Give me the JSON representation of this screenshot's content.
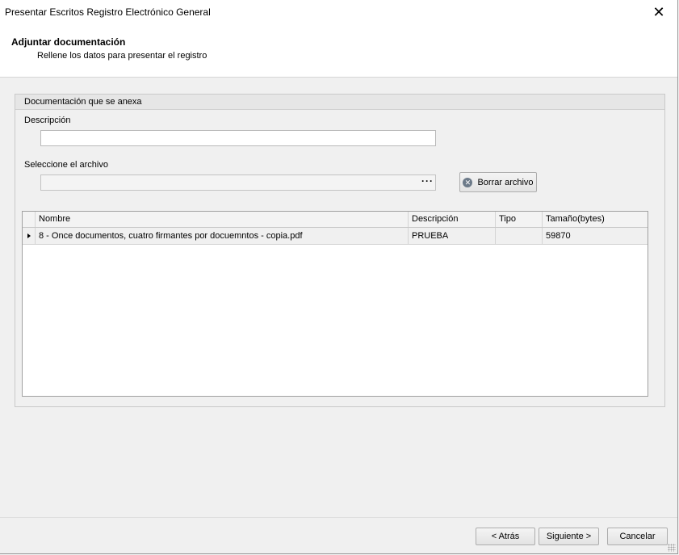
{
  "window": {
    "title": "Presentar Escritos Registro Electrónico General",
    "close_glyph": "✕"
  },
  "header": {
    "title": "Adjuntar documentación",
    "subtitle": "Rellene los datos para presentar el registro"
  },
  "group": {
    "title": "Documentación que se anexa",
    "description_label": "Descripción",
    "description_value": "",
    "file_label": "Seleccione el archivo",
    "file_value": "",
    "browse_glyph": "···",
    "clear_button_label": "Borrar archivo",
    "clear_icon": "delete-circle-icon"
  },
  "grid": {
    "columns": [
      "Nombre",
      "Descripción",
      "Tipo",
      "Tamaño(bytes)"
    ],
    "rows": [
      {
        "nombre": "8 - Once documentos, cuatro firmantes por docuemntos - copia.pdf",
        "descripcion": "PRUEBA",
        "tipo": "",
        "tamano": "59870"
      }
    ]
  },
  "footer": {
    "back_label": "< Atrás",
    "next_label": "Siguiente >",
    "cancel_label": "Cancelar"
  }
}
